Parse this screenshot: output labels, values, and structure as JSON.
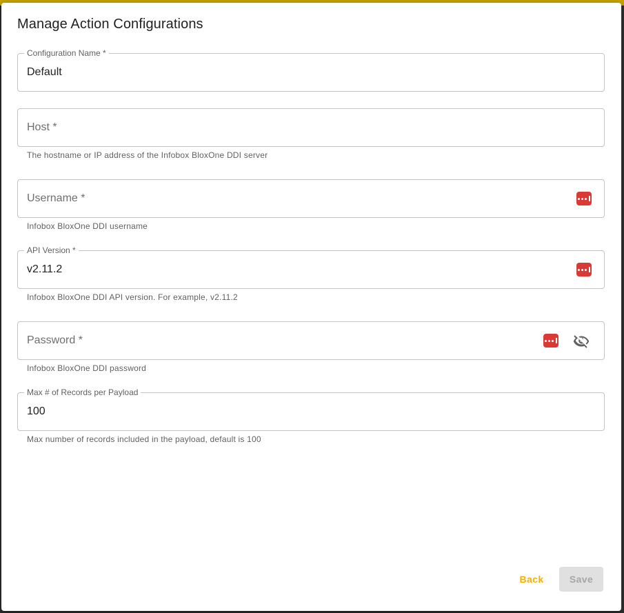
{
  "dialog": {
    "title": "Manage Action Configurations"
  },
  "fields": {
    "config_name": {
      "label": "Configuration Name *",
      "value": "Default"
    },
    "host": {
      "placeholder": "Host *",
      "helper": "The hostname or IP address of the Infobox BloxOne DDI server"
    },
    "username": {
      "placeholder": "Username *",
      "helper": "Infobox BloxOne DDI username",
      "icon": "password-manager-icon"
    },
    "api_version": {
      "label": "API Version *",
      "value": "v2.11.2",
      "helper": "Infobox BloxOne DDI API version. For example, v2.11.2",
      "icon": "password-manager-icon"
    },
    "password": {
      "placeholder": "Password *",
      "helper": "Infobox BloxOne DDI password",
      "icon": "password-manager-icon",
      "toggle_icon": "eye-off-icon"
    },
    "max_records": {
      "label": "Max # of Records per Payload",
      "value": "100",
      "helper": "Max number of records included in the payload, default is 100"
    }
  },
  "actions": {
    "back_label": "Back",
    "save_label": "Save"
  },
  "colors": {
    "accent": "#f2b200",
    "password_manager": "#d93a36",
    "disabled_bg": "#e0e0e0"
  }
}
